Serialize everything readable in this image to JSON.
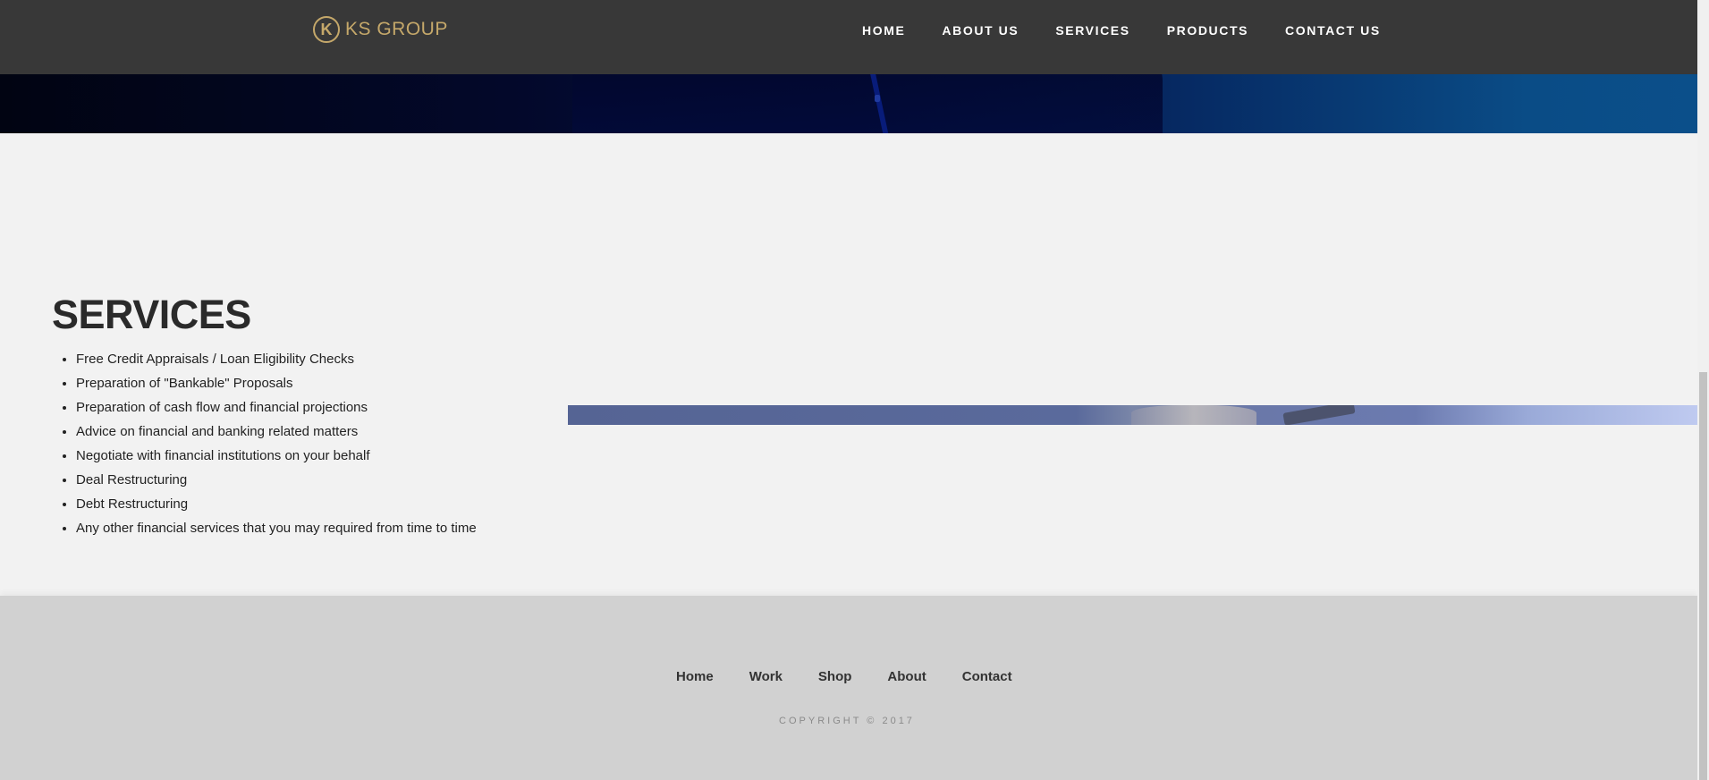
{
  "header": {
    "logo_mark": "K",
    "logo_text": "KS GROUP",
    "nav": [
      "HOME",
      "ABOUT US",
      "SERVICES",
      "PRODUCTS",
      "CONTACT US"
    ]
  },
  "services": {
    "title": "SERVICES",
    "items": [
      "Free Credit Appraisals / Loan Eligibility Checks",
      "Preparation of \"Bankable\" Proposals",
      "Preparation of cash flow and financial projections",
      "Advice on financial and banking related matters",
      "Negotiate with financial institutions on your behalf",
      "Deal Restructuring",
      "Debt Restructuring",
      "Any other financial services that you may required from time to time"
    ]
  },
  "footer": {
    "nav": [
      "Home",
      "Work",
      "Shop",
      "About",
      "Contact"
    ],
    "copyright": "COPYRIGHT © 2017"
  },
  "colors": {
    "header_bg": "#383838",
    "logo_gold": "#c5a86a",
    "page_bg": "#f2f2f2",
    "footer_bg": "#d1d1d1"
  }
}
